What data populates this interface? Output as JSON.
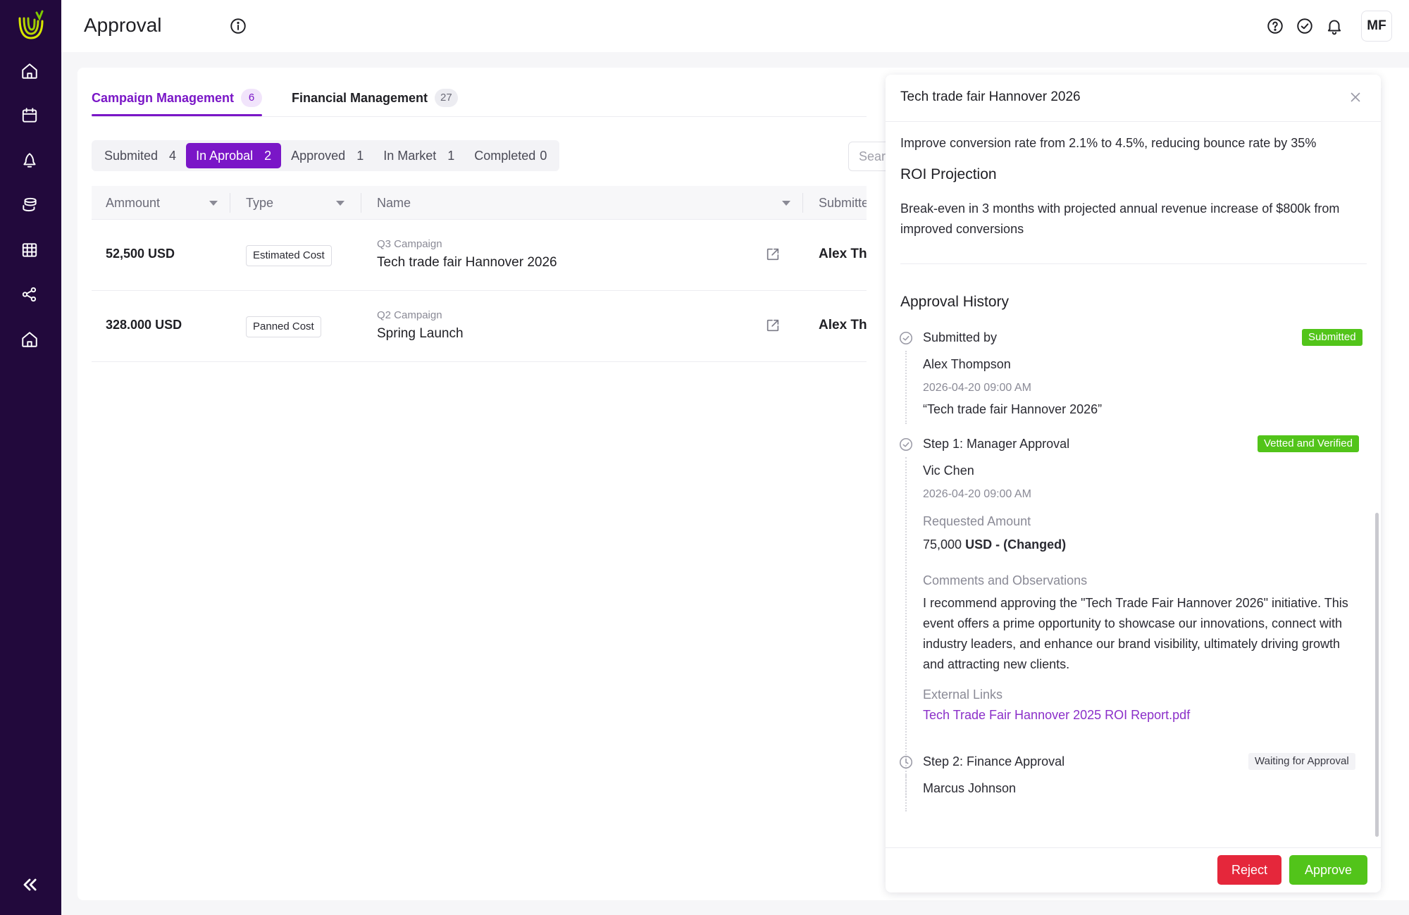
{
  "header": {
    "title": "Approval",
    "avatar_initials": "MF"
  },
  "tabs": [
    {
      "label": "Campaign Management",
      "count": "6"
    },
    {
      "label": "Financial Management",
      "count": "27"
    }
  ],
  "filters": [
    {
      "label": "Submited",
      "count": "4"
    },
    {
      "label": "In Aprobal",
      "count": "2"
    },
    {
      "label": "Approved",
      "count": "1"
    },
    {
      "label": "In Market",
      "count": "1"
    },
    {
      "label": "Completed",
      "count": "0"
    }
  ],
  "search": {
    "placeholder": "Sear"
  },
  "table": {
    "columns": [
      "Ammount",
      "Type",
      "Name",
      "Submitter"
    ],
    "rows": [
      {
        "amount": "52,500 USD",
        "type": "Estimated Cost",
        "campaign": "Q3 Campaign",
        "name": "Tech trade fair Hannover 2026",
        "submitter": "Alex Thom"
      },
      {
        "amount": "328.000 USD",
        "type": "Panned Cost",
        "campaign": "Q2 Campaign",
        "name": "Spring Launch",
        "submitter": "Alex Thom"
      }
    ]
  },
  "drawer": {
    "title": "Tech trade fair Hannover 2026",
    "objective": "Improve conversion rate from 2.1% to 4.5%, reducing bounce rate by 35%",
    "roi_heading": "ROI Projection",
    "roi_line1": "Break-even in 3 months with projected annual revenue increase of $800k from",
    "roi_line2": "improved conversions",
    "history_heading": "Approval History",
    "steps": [
      {
        "title": "Submitted by",
        "status": "Submitted",
        "person": "Alex Thompson",
        "date": "2026-04-20 09:00 AM",
        "quote": "“Tech trade fair Hannover 2026”"
      },
      {
        "title": "Step 1: Manager Approval",
        "status": "Vetted and Verified",
        "person": "Vic Chen",
        "date": "2026-04-20 09:00 AM",
        "amount_label": "Requested Amount",
        "amount_value": "75,000",
        "amount_suffix": "USD - (Changed)",
        "comments_label": "Comments and Observations",
        "comments_lines": [
          "I recommend approving the \"Tech Trade Fair Hannover 2026\" initiative. This",
          "event offers a prime opportunity to showcase our innovations, connect with",
          "industry leaders, and enhance our brand visibility, ultimately driving growth",
          "and attracting new clients."
        ],
        "links_label": "External Links",
        "link_text": "Tech Trade Fair Hannover 2025 ROI Report.pdf"
      },
      {
        "title": "Step 2: Finance Approval",
        "status": "Waiting for Approval",
        "person": "Marcus Johnson"
      }
    ],
    "reject_label": "Reject",
    "approve_label": "Approve"
  },
  "colors": {
    "sidebar": "#22093c",
    "accent": "#7a16c7",
    "success": "#52c41a",
    "danger": "#e5273b"
  }
}
